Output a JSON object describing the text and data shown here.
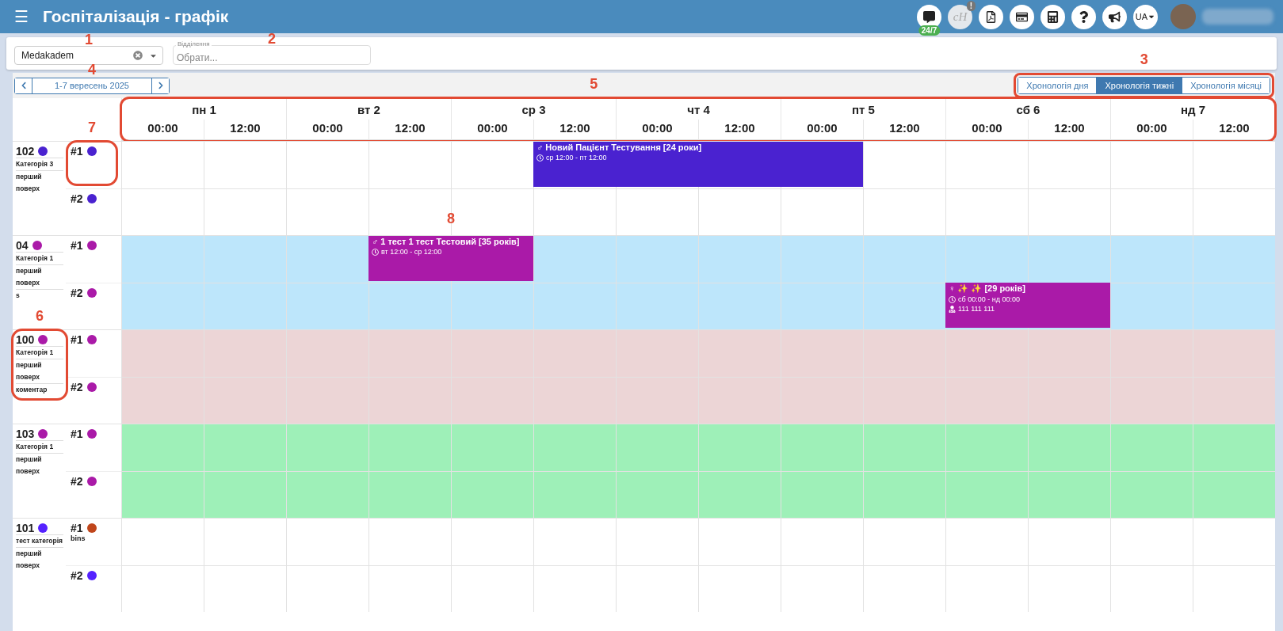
{
  "header": {
    "title": "Госпіталізація - графік",
    "menu": "☰",
    "tools": [
      {
        "kind": "chat",
        "badge": "24/7"
      },
      {
        "kind": "logo",
        "label": "cH",
        "badge": "!"
      },
      {
        "kind": "pdf"
      },
      {
        "kind": "card"
      },
      {
        "kind": "calculator"
      },
      {
        "kind": "help"
      },
      {
        "kind": "megaphone"
      },
      {
        "kind": "language",
        "label": "UA"
      }
    ]
  },
  "filters": {
    "company": {
      "value": "Medakadem",
      "callout": {
        "number": "1"
      }
    },
    "department": {
      "label": "Відділення",
      "placeholder": "Обрати...",
      "callout": {
        "number": "2"
      }
    }
  },
  "toolbar": {
    "date_range": "1-7 вересень 2025",
    "date_callout": {
      "number": "4"
    },
    "callout": {
      "number": "5"
    },
    "views": [
      {
        "label": "Хронологія дня",
        "selected": false
      },
      {
        "label": "Хронологія тижні",
        "selected": true
      },
      {
        "label": "Хронологія місяці",
        "selected": false
      }
    ],
    "views_callout": {
      "number": "3",
      "boxed": true
    }
  },
  "days_boxed": true,
  "days": [
    {
      "label": "пн 1",
      "times": [
        "00:00",
        "12:00"
      ]
    },
    {
      "label": "вт 2",
      "times": [
        "00:00",
        "12:00"
      ]
    },
    {
      "label": "ср 3",
      "times": [
        "00:00",
        "12:00"
      ]
    },
    {
      "label": "чт 4",
      "times": [
        "00:00",
        "12:00"
      ]
    },
    {
      "label": "пт 5",
      "times": [
        "00:00",
        "12:00"
      ]
    },
    {
      "label": "сб 6",
      "times": [
        "00:00",
        "12:00"
      ]
    },
    {
      "label": "нд 7",
      "times": [
        "00:00",
        "12:00"
      ]
    }
  ],
  "rooms": [
    {
      "number": "102",
      "color": "#4a22d0",
      "band": {
        "color": "#ffffff"
      },
      "details": [
        "Категорія 3",
        "перший поверх"
      ],
      "slots": [
        {
          "label": "#1",
          "color": "#4a22d0",
          "callout": {
            "number": "7",
            "boxed": true
          },
          "events": [
            {
              "sex": "♂",
              "title": "Новий Пацієнт Тестування [24 роки]",
              "time": "ср 12:00 - пт 12:00",
              "color": "#4a22d0"
            }
          ]
        },
        {
          "label": "#2",
          "color": "#4a22d0"
        }
      ]
    },
    {
      "number": "04",
      "color": "#aa1aa8",
      "band": {
        "color": "#bde6fb"
      },
      "details": [
        "Категорія 1",
        "перший поверх",
        "s"
      ],
      "slots": [
        {
          "label": "#1",
          "color": "#aa1aa8",
          "events": [
            {
              "sex": "♂",
              "title": "1 тест 1 тест Тестовий [35 років]",
              "time": "вт 12:00 - ср 12:00",
              "color": "#aa1aa8",
              "callout": {
                "number": "8"
              }
            }
          ]
        },
        {
          "label": "#2",
          "color": "#aa1aa8",
          "events": [
            {
              "sex": "♀",
              "title": "✨ ✨ [29 років]",
              "time": "сб 00:00 - нд 00:00",
              "contact": "111 111 111",
              "color": "#aa1aa8"
            }
          ]
        }
      ]
    },
    {
      "number": "100",
      "color": "#aa1aa8",
      "band": {
        "color": "#ecd5d6"
      },
      "details": [
        "Категорія 1",
        "перший поверх",
        "коментар"
      ],
      "callout": {
        "number": "6",
        "boxed": true
      },
      "slots": [
        {
          "label": "#1",
          "color": "#aa1aa8"
        },
        {
          "label": "#2",
          "color": "#aa1aa8"
        }
      ]
    },
    {
      "number": "103",
      "color": "#aa1aa8",
      "band": {
        "color": "#9ef0b8"
      },
      "details": [
        "Категорія 1",
        "перший поверх"
      ],
      "slots": [
        {
          "label": "#1",
          "color": "#aa1aa8"
        },
        {
          "label": "#2",
          "color": "#aa1aa8"
        }
      ]
    },
    {
      "number": "101",
      "color": "#5522ff",
      "band": {
        "color": "#ffffff"
      },
      "details": [
        "тест категорія",
        "перший поверх"
      ],
      "slots": [
        {
          "label": "#1",
          "color": "#c0461b",
          "note": "bins"
        },
        {
          "label": "#2",
          "color": "#5522ff"
        }
      ]
    }
  ]
}
